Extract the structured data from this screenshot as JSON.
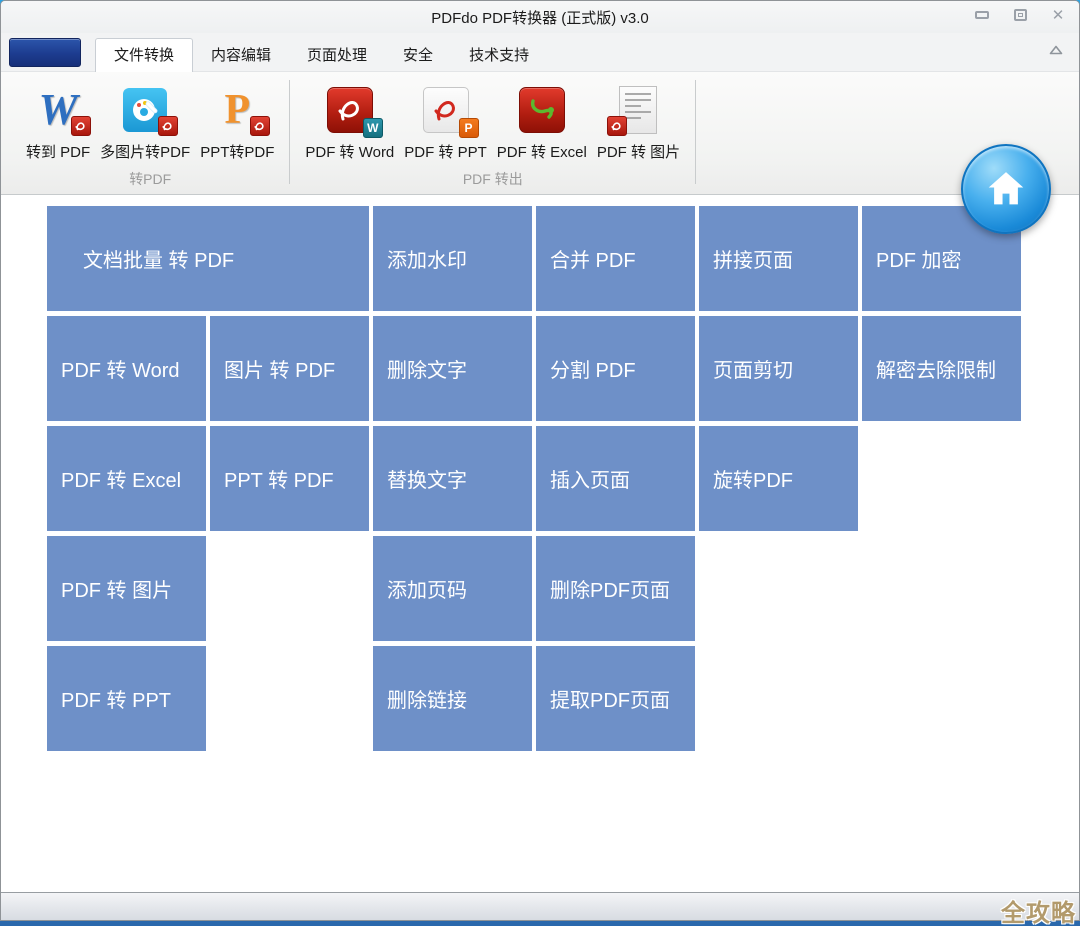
{
  "window": {
    "title": "PDFdo  PDF转换器  (正式版) v3.0",
    "controls": [
      {
        "name": "minimize-button",
        "icon": "minimize-icon"
      },
      {
        "name": "maximize-button",
        "icon": "maximize-icon"
      },
      {
        "name": "close-button",
        "icon": "close-icon",
        "glyph": "✕"
      }
    ]
  },
  "tabs": [
    {
      "label": "文件转换",
      "active": true
    },
    {
      "label": "内容编辑",
      "active": false
    },
    {
      "label": "页面处理",
      "active": false
    },
    {
      "label": "安全",
      "active": false
    },
    {
      "label": "技术支持",
      "active": false
    }
  ],
  "ribbon": {
    "toggle_icon": "chevron-up-icon",
    "groups": [
      {
        "label": "转PDF",
        "items": [
          {
            "label": "转到 PDF",
            "icon": "word-to-pdf-icon",
            "glyph": "W"
          },
          {
            "label": "多图片转PDF",
            "icon": "images-to-pdf-icon"
          },
          {
            "label": "PPT转PDF",
            "icon": "ppt-to-pdf-icon",
            "glyph": "P"
          }
        ]
      },
      {
        "label": "PDF 转出",
        "items": [
          {
            "label": "PDF 转 Word",
            "icon": "pdf-to-word-icon",
            "badge_glyph": "W"
          },
          {
            "label": "PDF 转 PPT",
            "icon": "pdf-to-ppt-icon",
            "badge_glyph": "P"
          },
          {
            "label": "PDF 转 Excel",
            "icon": "pdf-to-excel-icon"
          },
          {
            "label": "PDF 转 图片",
            "icon": "pdf-to-image-icon"
          }
        ]
      }
    ],
    "home_icon": "home-icon"
  },
  "main_grid": {
    "buttons": [
      {
        "label": "文档批量 转 PDF"
      },
      {
        "label": "添加水印"
      },
      {
        "label": "合并 PDF"
      },
      {
        "label": "拼接页面"
      },
      {
        "label": "PDF 加密"
      },
      {
        "label": "PDF 转 Word"
      },
      {
        "label": "图片 转 PDF"
      },
      {
        "label": "删除文字"
      },
      {
        "label": "分割 PDF"
      },
      {
        "label": "页面剪切"
      },
      {
        "label": "解密去除限制"
      },
      {
        "label": "PDF 转 Excel"
      },
      {
        "label": "PPT 转 PDF"
      },
      {
        "label": "替换文字"
      },
      {
        "label": "插入页面"
      },
      {
        "label": "旋转PDF"
      },
      {
        "label": "PDF 转 图片"
      },
      {
        "label": "添加页码"
      },
      {
        "label": "删除PDF页面"
      },
      {
        "label": "PDF 转 PPT"
      },
      {
        "label": "删除链接"
      },
      {
        "label": "提取PDF页面"
      }
    ]
  },
  "statusbar": {
    "watermark": "全攻略"
  },
  "colors": {
    "tile_blue": "#6e90c8",
    "home_blue": "#1a8ad8",
    "file_button_blue": "#1d3c8f",
    "pdf_red": "#b01d10",
    "watermark_gold": "#b29a6c"
  }
}
